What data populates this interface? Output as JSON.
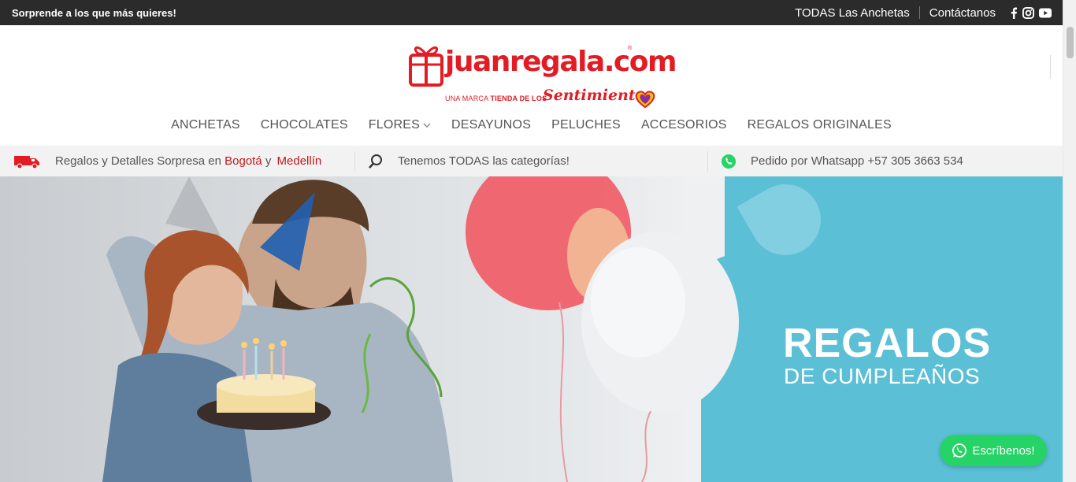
{
  "topbar": {
    "tagline": "Sorprende a los que más quieres!",
    "link_anchetas": "TODAS Las Anchetas",
    "link_contact": "Contáctanos",
    "social": [
      "facebook-icon",
      "instagram-icon",
      "youtube-icon"
    ]
  },
  "logo": {
    "brand": "juanregala.com",
    "reg": "®",
    "sub_prefix": "UNA MARCA",
    "sub_bold": "TIENDA DE LOS",
    "script": "Sentimientos"
  },
  "nav": {
    "items": [
      "ANCHETAS",
      "CHOCOLATES",
      "FLORES",
      "DESAYUNOS",
      "PELUCHES",
      "ACCESORIOS",
      "REGALOS ORIGINALES"
    ]
  },
  "infobar": {
    "delivery_text": "Regalos y Detalles Sorpresa en",
    "city1": "Bogotá",
    "connector": "y",
    "city2": "Medellín",
    "categories_text": "Tenemos TODAS las categorías!",
    "whatsapp_text": "Pedido por Whatsapp +57 305 3663 534"
  },
  "hero": {
    "title": "REGALOS",
    "subtitle": "DE CUMPLEAÑOS"
  },
  "whatsapp_button": {
    "label": "Escríbenos!"
  },
  "colors": {
    "brand_red": "#e31b23",
    "teal": "#5bbfd6",
    "whatsapp_green": "#25d366",
    "topbar_bg": "#2b2b2b"
  }
}
